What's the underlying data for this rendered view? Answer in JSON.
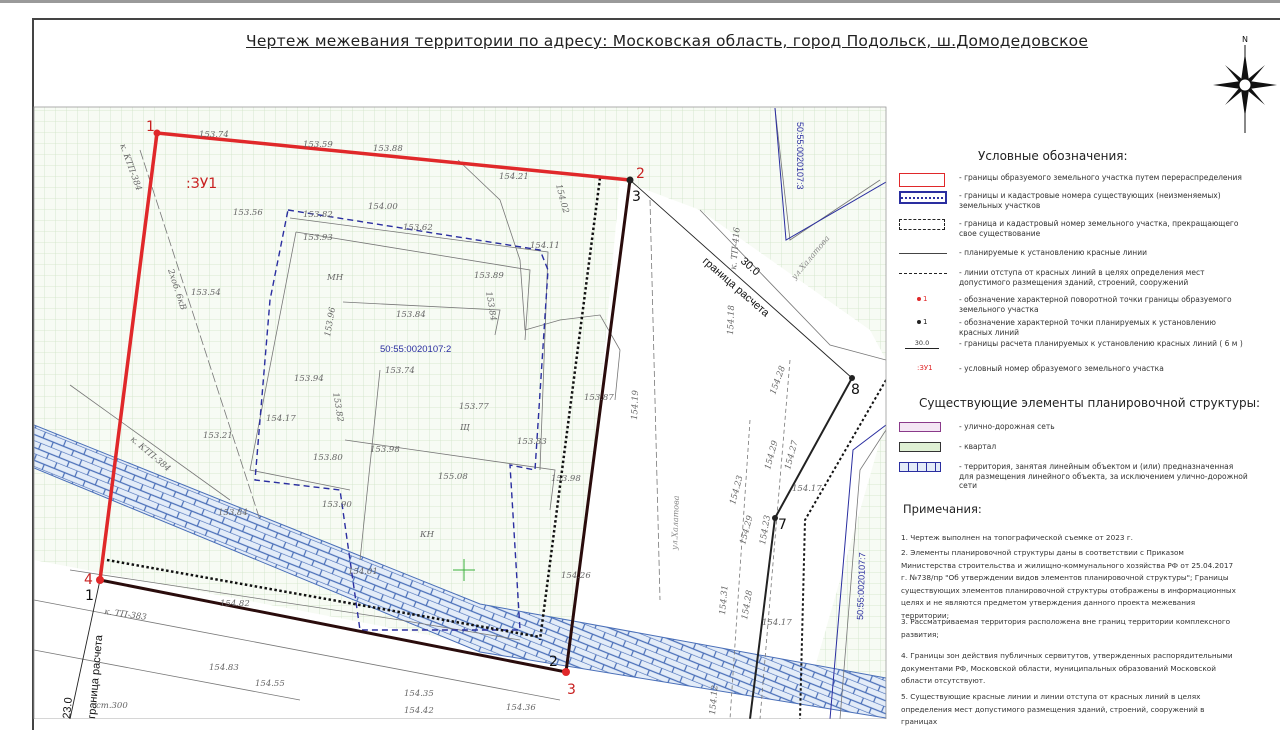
{
  "title": "Чертеж  межевания территории по адресу: Московская область, город Подольск, ш.Домодедовское",
  "compass": {
    "north_label": "N"
  },
  "map": {
    "parcel_label": ":ЗУ1",
    "cadastral_main": "50:55:0020107:2",
    "cadastral_ne": "50:55:0020107:3",
    "cadastral_se": "50:55:0020107:7",
    "boundary_calc_ne": "граница расчета",
    "boundary_calc_ne_dist": "30.0",
    "boundary_calc_sw": "граница расчета",
    "boundary_calc_sw_dist": "23.0",
    "street_1": "ул.Халатова",
    "street_2": "ул.Халатова",
    "points": {
      "p1": "1",
      "p2": "2",
      "p3": "3",
      "p4": "4",
      "p1b": "1",
      "p2b": "2",
      "p3b": "3",
      "p7": "7",
      "p8": "8"
    },
    "labels": [
      "153.74",
      "153.59",
      "153.88",
      "154.21",
      "154.02",
      "153.56",
      "154.00",
      "153.82",
      "153.93",
      "153.62",
      "154.11",
      "153.89",
      "153.84",
      "МН",
      "153.54",
      "153.96",
      "153.84",
      "153.74",
      "153.94",
      "153.82",
      "154.17",
      "153.77",
      "Щ",
      "153.21",
      "153.80",
      "153.98",
      "155.08",
      "153.83",
      "153.98",
      "153.90",
      "КН",
      "154.01",
      "153.84",
      "154.82",
      "154.26",
      "154.83",
      "154.55",
      "154.35",
      "154.36",
      "ст.300",
      "к. КТП-384",
      "2хоб. 6кВ",
      "к. КТП-384",
      "к. ТП-383",
      "к. ТП-416",
      "154.18",
      "154.19",
      "153.87",
      "154.28",
      "154.29",
      "154.27",
      "154.23",
      "154.29",
      "154.23",
      "154.17",
      "154.12",
      "154.31",
      "154.28",
      "154.17",
      "154.42"
    ]
  },
  "legend": {
    "title": "Условные обозначения:",
    "items": [
      "- границы образуемого земельного участка путем перераспределения",
      "- границы и кадастровые номера существующих (неизменяемых) земельных участков",
      "- граница и кадастровый номер земельного участка, прекращающего свое существование",
      "- планируемые к установлению красные линии",
      "- линии отступа от красных линий в целях определения мест допустимого размещения зданий, строений, сооружений",
      "- обозначение характерной поворотной точки границы образуемого земельного участка",
      "- обозначение характерной точки планируемых к установлению красных линий",
      "- границы расчета планируемых к установлению красных линий ( 6 м )",
      "- условный номер образуемого земельного участка"
    ],
    "sym_point": "1",
    "sym_dist": "30.0",
    "sym_parcel": ":ЗУ1",
    "colors": {
      "red": "#e0282a",
      "blue": "#2a2ea0",
      "green": "#cfe8c8"
    }
  },
  "structure": {
    "title": "Существующие элементы планировочной структуры:",
    "items": [
      "- улично-дорожная сеть",
      "- квартал",
      "- территория, занятая линейным объектом и (или) предназначенная для размещения линейного объекта, за исключением улично-дорожной сети"
    ]
  },
  "notes": {
    "title": "Примечания:",
    "items": [
      "1. Чертеж выполнен на топографической съемке от 2023 г.",
      "2. Элементы планировочной структуры даны в соответствии с Приказом Министерства строительства и жилищно-коммунального хозяйства РФ от 25.04.2017 г. №738/пр \"Об утверждении видов элементов планировочной структуры\"; Границы существующих элементов планировочной структуры отображены в информационных целях и не являются предметом утверждения данного проекта межевания территории;",
      "3. Рассматриваемая территория расположена вне границ территории комплексного развития;",
      "4. Границы зон действия публичных сервитутов, утвержденных распорядительными документами РФ, Московской области, муниципальных образований Московской области отсутствуют.",
      "5. Существующие красные линии и линии отступа от красных линий в целях определения мест допустимого размещения зданий, строений, сооружений в границах"
    ]
  }
}
